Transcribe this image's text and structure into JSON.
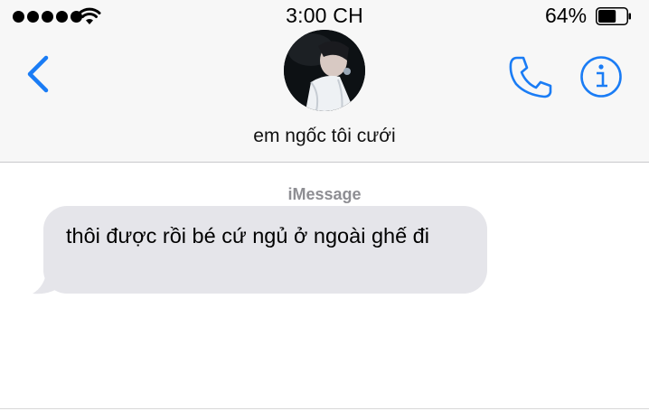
{
  "status_bar": {
    "time": "3:00 CH",
    "battery_percent": "64%",
    "signal_bars": 5,
    "battery_level": 0.64
  },
  "nav": {
    "back_icon": "chevron-left-icon",
    "contact_name": "em ngốc tôi cưới",
    "call_icon": "phone-icon",
    "info_icon": "info-icon"
  },
  "conversation": {
    "service_label": "iMessage",
    "messages": [
      {
        "direction": "incoming",
        "text": "thôi được rồi bé cứ ngủ ở ngoài ghế đi"
      }
    ]
  },
  "colors": {
    "accent": "#1a7cf5",
    "incoming_bubble": "#e5e5ea",
    "header_bg": "#f7f7f7",
    "service_label": "#8e8e93"
  }
}
